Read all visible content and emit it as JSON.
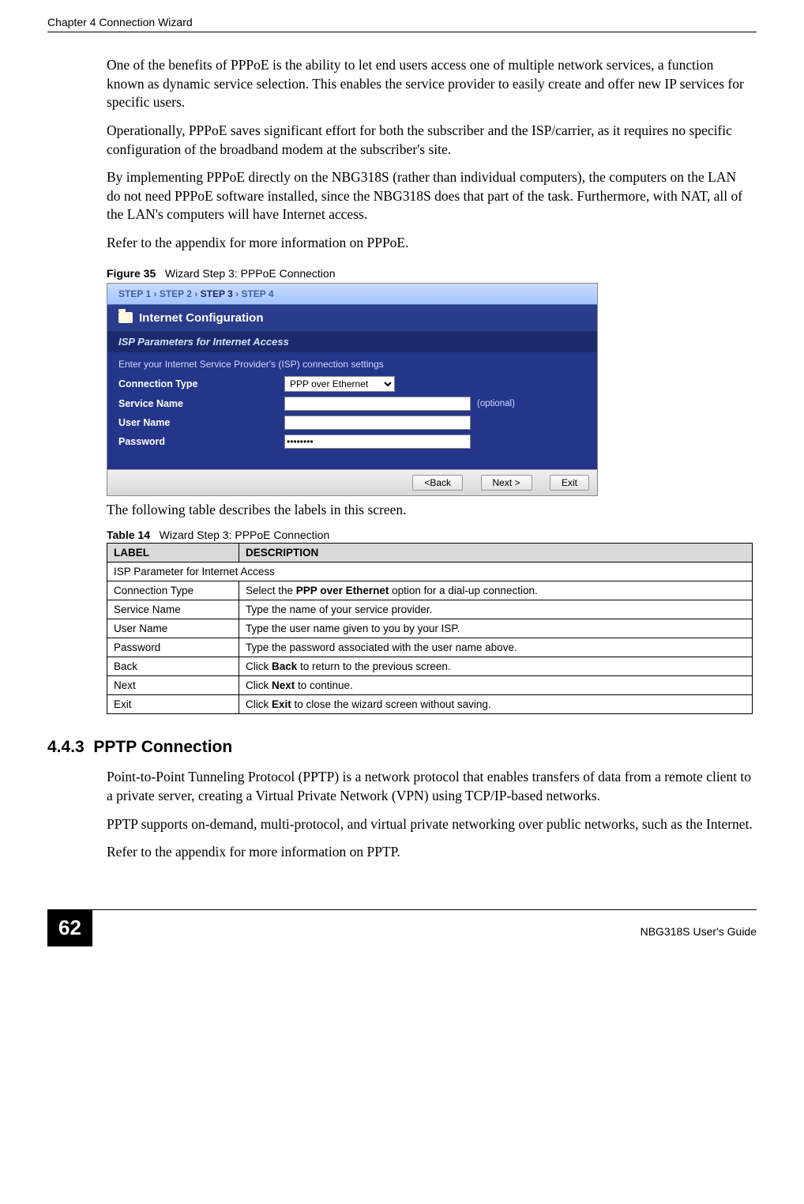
{
  "header": {
    "left": "Chapter 4 Connection Wizard",
    "right": ""
  },
  "paragraphs": {
    "p1": "One of the benefits of PPPoE is the ability to let end users access one of multiple network services, a function known as dynamic service selection. This enables the service provider to easily create and offer new IP services for specific users.",
    "p2": "Operationally, PPPoE saves significant effort for both the subscriber and the ISP/carrier, as it requires no specific configuration of the broadband modem at the subscriber's site.",
    "p3": "By implementing PPPoE directly on the NBG318S (rather than individual computers), the computers on the LAN do not need PPPoE software installed, since the NBG318S does that part of the task. Furthermore, with NAT, all of the LAN's computers will have Internet access.",
    "p4": "Refer to the appendix for more information on PPPoE.",
    "after_table": "The following table describes the labels in this screen.",
    "p5": "Point-to-Point Tunneling Protocol (PPTP) is a network protocol that enables transfers of data from a remote client to a private server, creating a Virtual Private Network (VPN) using TCP/IP-based networks.",
    "p6": "PPTP supports on-demand, multi-protocol, and virtual private networking over public networks, such as the Internet.",
    "p7": "Refer to the appendix for more information on PPTP."
  },
  "figure": {
    "label": "Figure 35",
    "title": "Wizard Step 3: PPPoE Connection"
  },
  "screenshot": {
    "steps": {
      "s1": "STEP 1",
      "s2": "STEP 2",
      "s3": "STEP 3",
      "s4": "STEP 4",
      "sep": " › "
    },
    "title": "Internet Configuration",
    "subhead": "ISP Parameters for Internet Access",
    "hint": "Enter your Internet Service Provider's (ISP) connection settings",
    "labels": {
      "conn_type": "Connection Type",
      "service_name": "Service Name",
      "user_name": "User Name",
      "password": "Password",
      "optional": "(optional)"
    },
    "values": {
      "conn_type": "PPP over Ethernet",
      "service_name": "",
      "user_name": "",
      "password": "********"
    },
    "buttons": {
      "back": "<Back",
      "next": "Next >",
      "exit": "Exit"
    }
  },
  "table": {
    "label": "Table 14",
    "title": "Wizard Step 3: PPPoE Connection",
    "headers": {
      "label": "LABEL",
      "desc": "DESCRIPTION"
    },
    "span_row": "ISP Parameter for Internet Access",
    "rows": [
      {
        "label": "Connection Type",
        "desc_pre": "Select the ",
        "desc_bold": "PPP over Ethernet",
        "desc_post": " option for a dial-up connection."
      },
      {
        "label": "Service Name",
        "desc_pre": "Type the name of your service provider.",
        "desc_bold": "",
        "desc_post": ""
      },
      {
        "label": "User Name",
        "desc_pre": "Type the user name given to you by your ISP.",
        "desc_bold": "",
        "desc_post": ""
      },
      {
        "label": "Password",
        "desc_pre": "Type the password associated with the user name above.",
        "desc_bold": "",
        "desc_post": ""
      },
      {
        "label": "Back",
        "desc_pre": "Click ",
        "desc_bold": "Back",
        "desc_post": " to return to the previous screen."
      },
      {
        "label": "Next",
        "desc_pre": "Click ",
        "desc_bold": "Next",
        "desc_post": " to continue."
      },
      {
        "label": "Exit",
        "desc_pre": "Click ",
        "desc_bold": "Exit",
        "desc_post": " to close the wizard screen without saving."
      }
    ]
  },
  "section": {
    "number": "4.4.3",
    "title": "PPTP Connection"
  },
  "footer": {
    "page": "62",
    "guide": "NBG318S User's Guide"
  }
}
